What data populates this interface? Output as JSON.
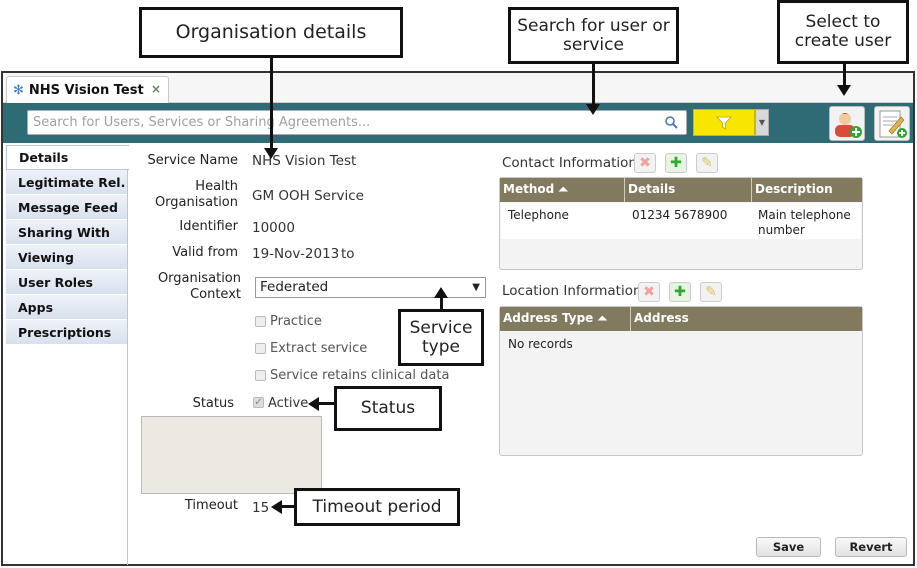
{
  "callouts": {
    "org_details": "Organisation details",
    "search": "Search for user or service",
    "create_user": "Select to create user",
    "service_type": "Service type",
    "status": "Status",
    "timeout": "Timeout period"
  },
  "tab": {
    "label": "NHS Vision Test",
    "close": "×"
  },
  "toolbar": {
    "search_placeholder": "Search for Users, Services or Sharing Agreements...",
    "filter_color": "#f6e600",
    "toolbar_color": "#2f6b75"
  },
  "sidebar": {
    "items": [
      {
        "label": "Details",
        "active": true
      },
      {
        "label": "Legitimate Rel."
      },
      {
        "label": "Message Feed"
      },
      {
        "label": "Sharing With"
      },
      {
        "label": "Viewing"
      },
      {
        "label": "User Roles"
      },
      {
        "label": "Apps"
      },
      {
        "label": "Prescriptions"
      }
    ]
  },
  "form": {
    "service_name_label": "Service Name",
    "service_name": "NHS Vision Test",
    "health_org_label": "Health Organisation",
    "health_org": "GM OOH Service",
    "identifier_label": "Identifier",
    "identifier": "10000",
    "valid_from_label": "Valid from",
    "valid_from": "19-Nov-2013",
    "valid_to": "to",
    "org_context_label": "Organisation Context",
    "org_context": "Federated",
    "practice": "Practice",
    "extract_service": "Extract service",
    "retains_data": "Service retains clinical data",
    "status_label": "Status",
    "status_value": "Active",
    "timeout_label": "Timeout",
    "timeout": "15"
  },
  "contact": {
    "title": "Contact Information",
    "columns": [
      "Method",
      "Details",
      "Description"
    ],
    "rows": [
      {
        "method": "Telephone",
        "details": "01234 5678900",
        "description": "Main telephone number"
      }
    ]
  },
  "location": {
    "title": "Location Information",
    "columns": [
      "Address Type",
      "Address"
    ],
    "empty": "No records"
  },
  "buttons": {
    "save": "Save",
    "revert": "Revert"
  }
}
